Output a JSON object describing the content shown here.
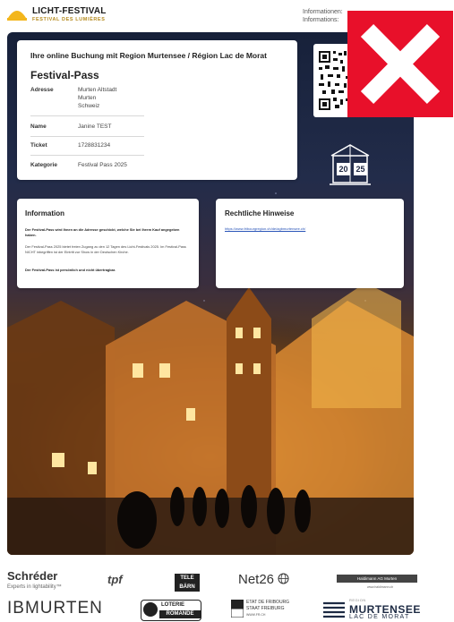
{
  "header": {
    "brand_title": "LICHT-FESTIVAL",
    "brand_subtitle": "FESTIVAL DES LUMIÈRES",
    "info_line_1": "Informationen:",
    "info_line_2": "Informations:"
  },
  "booking": {
    "title": "Ihre online Buchung mit Region Murtensee / Région Lac de Morat",
    "pass_title": "Festival-Pass",
    "address_label": "Adresse",
    "address_lines": [
      "Murten Altstadt",
      "Murten",
      "Schweiz"
    ],
    "name_label": "Name",
    "name_value": "Janine TEST",
    "ticket_label": "Ticket",
    "ticket_value": "1728831234",
    "category_label": "Kategorie",
    "category_value": "Festival Pass 2025"
  },
  "badge": {
    "left": "20",
    "right": "25"
  },
  "information": {
    "title": "Information",
    "p1": "Der Festival-Pass wird Ihnen an die Adresse geschickt, welche Sie bei Ihrem Kauf angegeben haben.",
    "p2": "Der Festival-Pass 2025 bietet freien Zugang zu den 12 Tagen des Licht-Festivals 2025. Im Festival-Pass NICHT inbegriffen ist der Eintritt zur Show in der Deutschen Kirche.",
    "p3": "Der Festival-Pass ist persönlich und nicht übertragbar."
  },
  "legal": {
    "title": "Rechtliche Hinweise",
    "link": "https://www.fribourgregion.ch/de/agbmurtensee.ch/"
  },
  "sponsors": {
    "schreder": "Schréder",
    "schreder_tagline": "Experts in lightability™",
    "tpf": "tpf",
    "tele_line1": "TELE",
    "tele_line2": "BÄRN",
    "net26": "Net26",
    "haldimann": "Haldimann AG Murten",
    "haldimann_url": "www.haldimann.ch",
    "ibmurten": "IBMURTEN",
    "loterie_1": "LOTERIE",
    "loterie_2": "ROMANDE",
    "fribourg_1": "ETAT DE FRIBOURG",
    "fribourg_2": "STAAT FREIBURG",
    "fribourg_3": "WWW.FR.CH",
    "murtensee_region": "REGION",
    "murtensee_1": "MURTENSEE",
    "murtensee_2": "LAC DE MORAT"
  },
  "colors": {
    "close_red": "#e8102a",
    "link_blue": "#2a55b8",
    "night_sky": "#17213a",
    "lamp_gold": "#e9a236"
  },
  "icons": [
    "licht-festival-logo-icon",
    "qr-code-icon",
    "close-x-icon",
    "calendar-2025-icon",
    "net26-globe-icon"
  ]
}
